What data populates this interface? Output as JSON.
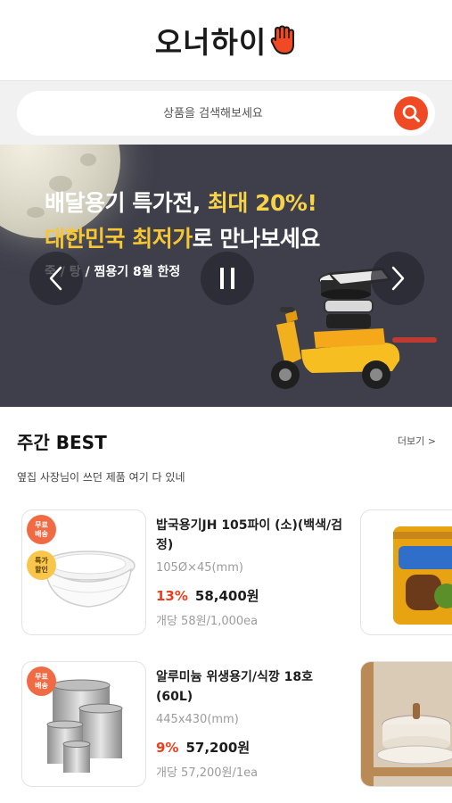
{
  "header": {
    "logo_text": "오너하이",
    "logo_icon": "hand-icon"
  },
  "search": {
    "placeholder": "상품을 검색해보세요",
    "icon": "search-icon"
  },
  "banner": {
    "line1_prefix": "배달용기 특가전, ",
    "line1_highlight": "최대 20%!",
    "line2_highlight": "대한민국 최저가",
    "line2_suffix": "로 만나보세요",
    "subtitle": "죽 / 탕 / 찜용기 8월 한정",
    "prev_icon": "chevron-left-icon",
    "pause_icon": "pause-icon",
    "next_icon": "chevron-right-icon",
    "colors": {
      "background": "#3e3f4b",
      "highlight": "#f7c634"
    }
  },
  "weekly_best": {
    "title": "주간 BEST",
    "more": "더보기 >",
    "subtitle": "옆집 사장님이 쓰던 제품 여기 다 있네",
    "products": [
      {
        "badges": [
          [
            "무료",
            "배송"
          ],
          [
            "특가",
            "할인"
          ]
        ],
        "name": "밥국용기JH 105파이 (소)(백색/검정)",
        "spec": "105Ø×45(mm)",
        "discount": "13%",
        "price": "58,400원",
        "unit": "개당 58원/1,000ea"
      },
      {
        "badges": [
          [
            "무료",
            "배송"
          ]
        ],
        "name": "알루미늄 위생용기/식깡 18호(60L)",
        "spec": "445x430(mm)",
        "discount": "9%",
        "price": "57,200원",
        "unit": "개당 57,200원/1ea"
      }
    ]
  },
  "colors": {
    "accent": "#ef4a23",
    "discount": "#ee3d1d"
  }
}
